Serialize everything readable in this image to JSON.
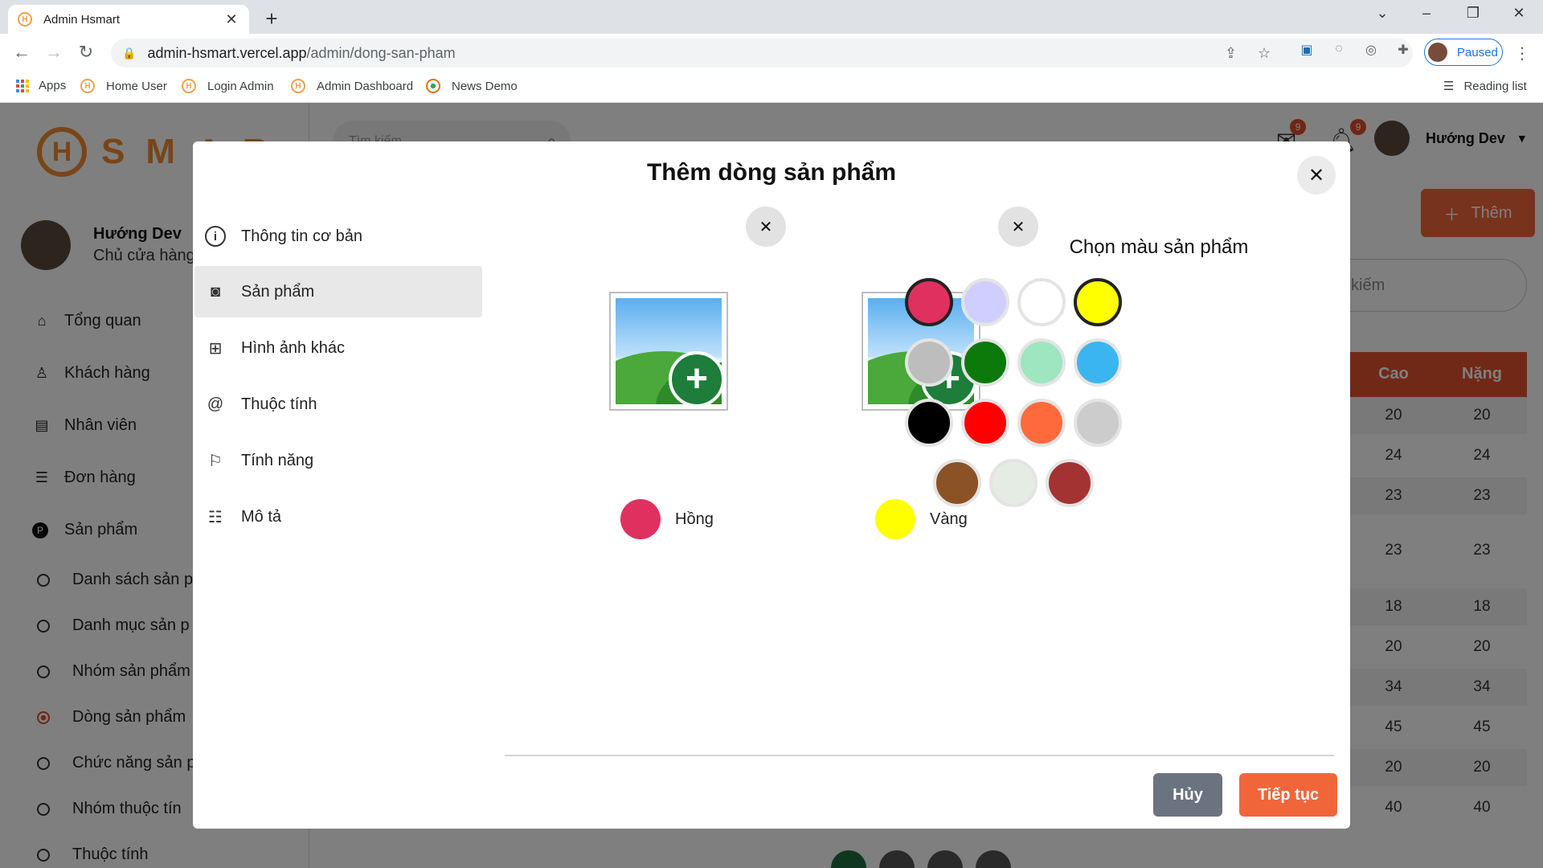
{
  "browser": {
    "tab_title": "Admin Hsmart",
    "favicon_letter": "H",
    "url_domain": "admin-hsmart.vercel.app",
    "url_path": "/admin/dong-san-pham",
    "profile_label": "Paused",
    "bookmarks": [
      {
        "label": "Apps",
        "icon": "apps-grid-icon"
      },
      {
        "label": "Home User",
        "icon": "hsmart-favicon"
      },
      {
        "label": "Login Admin",
        "icon": "hsmart-favicon"
      },
      {
        "label": "Admin Dashboard",
        "icon": "hsmart-favicon"
      },
      {
        "label": "News Demo",
        "icon": "news-favicon"
      }
    ],
    "reading_list": "Reading list"
  },
  "sidebar": {
    "logo_letter": "H",
    "logo_text": "SMAR",
    "user_name": "Hướng Dev",
    "user_role": "Chủ cửa hàng",
    "menu": [
      {
        "label": "Tổng quan",
        "icon": "home-icon"
      },
      {
        "label": "Khách hàng",
        "icon": "person-icon"
      },
      {
        "label": "Nhân viên",
        "icon": "badge-icon"
      },
      {
        "label": "Đơn hàng",
        "icon": "list-icon"
      },
      {
        "label": "Sản phẩm",
        "icon": "product-icon",
        "glyph": "P"
      }
    ],
    "submenu": [
      {
        "label": "Danh sách sản p"
      },
      {
        "label": "Danh mục sản p"
      },
      {
        "label": "Nhóm sản phẩm"
      },
      {
        "label": "Dòng sản phẩm"
      },
      {
        "label": "Chức năng sản p"
      },
      {
        "label": "Nhóm thuộc tín"
      },
      {
        "label": "Thuộc tính"
      }
    ]
  },
  "topbar": {
    "search_placeholder": "Tìm kiếm",
    "mail_count": "9",
    "notif_count": "9",
    "user_name": "Hướng Dev"
  },
  "page": {
    "add_button": "Thêm",
    "list_search_placeholder": "kiếm",
    "columns": [
      "Cao",
      "Nặng"
    ],
    "rows": [
      [
        "20",
        "20"
      ],
      [
        "24",
        "24"
      ],
      [
        "23",
        "23"
      ],
      [
        "23",
        "23"
      ],
      [
        "18",
        "18"
      ],
      [
        "20",
        "20"
      ],
      [
        "34",
        "34"
      ],
      [
        "45",
        "45"
      ],
      [
        "20",
        "20"
      ],
      [
        "40",
        "40"
      ]
    ]
  },
  "modal": {
    "title": "Thêm dòng sản phẩm",
    "steps": [
      {
        "label": "Thông tin cơ bản",
        "icon": "info-icon"
      },
      {
        "label": "Sản phẩm",
        "icon": "camera-icon",
        "active": true
      },
      {
        "label": "Hình ảnh khác",
        "icon": "add-image-icon"
      },
      {
        "label": "Thuộc tính",
        "icon": "at-icon"
      },
      {
        "label": "Tính năng",
        "icon": "flag-icon"
      },
      {
        "label": "Mô tả",
        "icon": "description-icon"
      }
    ],
    "variants": [
      {
        "color_name": "Hồng",
        "color": "#e0305f"
      },
      {
        "color_name": "Vàng",
        "color": "#ffff00"
      }
    ],
    "picker_title": "Chọn màu sản phẩm",
    "swatches": [
      {
        "color": "#e0305f",
        "selected": true
      },
      {
        "color": "#cfcfff",
        "selected": false
      },
      {
        "color": "#ffffff",
        "selected": false
      },
      {
        "color": "#ffff00",
        "selected": true
      },
      {
        "color": "#bdbdbd",
        "selected": false
      },
      {
        "color": "#0b7a0b",
        "selected": false
      },
      {
        "color": "#9ee6c0",
        "selected": false
      },
      {
        "color": "#3bb5f0",
        "selected": false
      },
      {
        "color": "#000000",
        "selected": false
      },
      {
        "color": "#ff0000",
        "selected": false
      },
      {
        "color": "#ff6a3d",
        "selected": false
      },
      {
        "color": "#cccccc",
        "selected": false
      },
      {
        "color": "#8b5226",
        "selected": false
      },
      {
        "color": "#e4ece4",
        "selected": false
      },
      {
        "color": "#a33233",
        "selected": false
      }
    ],
    "cancel_label": "Hủy",
    "next_label": "Tiếp tục"
  },
  "colors": {
    "accent": "#f0663a",
    "table_header": "#e0522d",
    "cancel": "#6b7280"
  }
}
